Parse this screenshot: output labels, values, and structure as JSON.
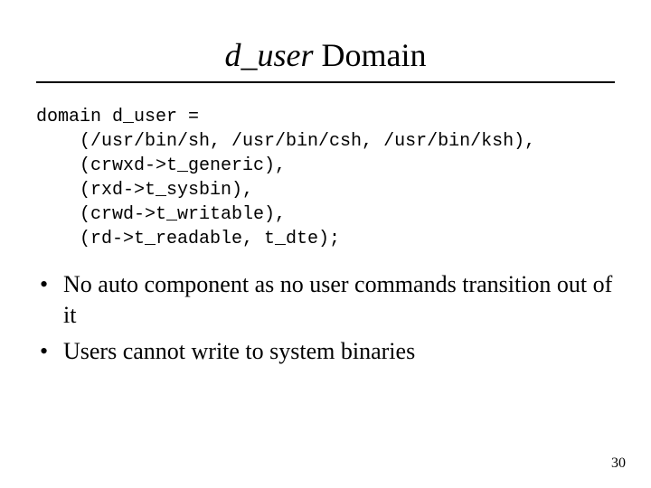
{
  "title": {
    "italic_part": "d_user",
    "rest": " Domain"
  },
  "code": {
    "line1": "domain d_user =",
    "line2": "    (/usr/bin/sh, /usr/bin/csh, /usr/bin/ksh),",
    "line3": "    (crwxd->t_generic),",
    "line4": "    (rxd->t_sysbin),",
    "line5": "    (crwd->t_writable),",
    "line6": "    (rd->t_readable, t_dte);"
  },
  "bullets": [
    "No auto component as no user commands transition out of it",
    "Users cannot write to system binaries"
  ],
  "page_number": "30"
}
